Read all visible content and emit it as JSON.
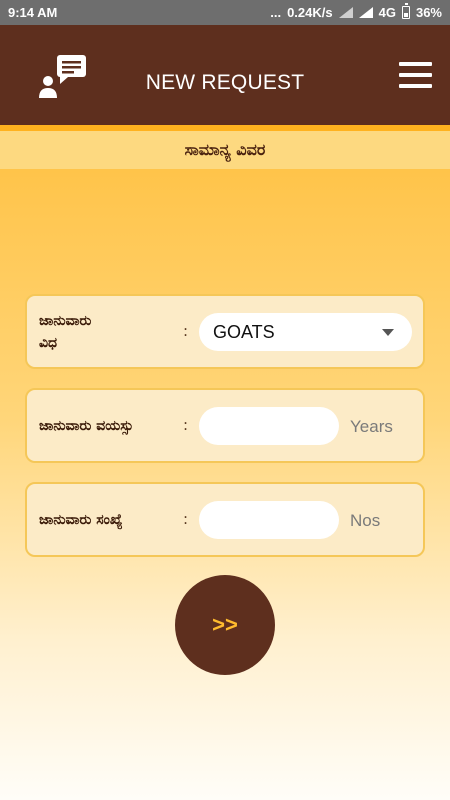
{
  "status_bar": {
    "time": "9:14 AM",
    "dots": "...",
    "speed": "0.24K/s",
    "network": "4G",
    "battery": "36%"
  },
  "header": {
    "icon": "chat-request-icon",
    "title": "NEW REQUEST",
    "menu_icon": "hamburger-menu-icon"
  },
  "section": {
    "title": "ಸಾಮಾನ್ಯ ವಿವರ"
  },
  "form": {
    "animal_type": {
      "label_line1": "ಜಾನುವಾರು",
      "label_line2": "ವಿಧ",
      "colon": ":",
      "value": "GOATS"
    },
    "animal_age": {
      "label": "ಜಾನುವಾರು ವಯಸ್ಸು",
      "colon": ":",
      "value": "",
      "unit": "Years"
    },
    "animal_count": {
      "label": "ಜಾನುವಾರು ಸಂಖ್ಯೆ",
      "colon": ":",
      "value": "",
      "unit": "Nos"
    }
  },
  "next_button": {
    "label": ">>"
  },
  "colors": {
    "header_bg": "#5e2f1e",
    "accent": "#ffbc2e",
    "card_bg": "#fcebc7",
    "card_border": "#f5c758"
  }
}
